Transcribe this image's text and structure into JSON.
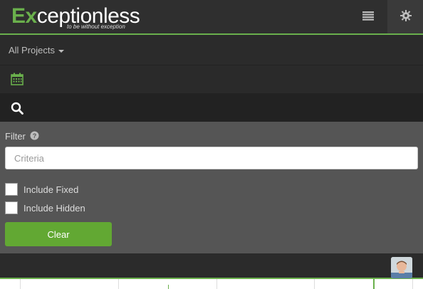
{
  "header": {
    "logo_text_main": "Exceptionless",
    "logo_tagline": "to be without exception",
    "accent_color": "#6ab04c"
  },
  "projects": {
    "selected": "All Projects"
  },
  "filter": {
    "label": "Filter",
    "criteria_placeholder": "Criteria",
    "include_fixed_label": "Include Fixed",
    "include_hidden_label": "Include Hidden",
    "include_fixed_checked": false,
    "include_hidden_checked": false,
    "clear_label": "Clear"
  },
  "icons": {
    "menu": "menu-icon",
    "gear": "gear-icon",
    "calendar": "calendar-icon",
    "search": "search-icon",
    "help": "help-icon"
  }
}
